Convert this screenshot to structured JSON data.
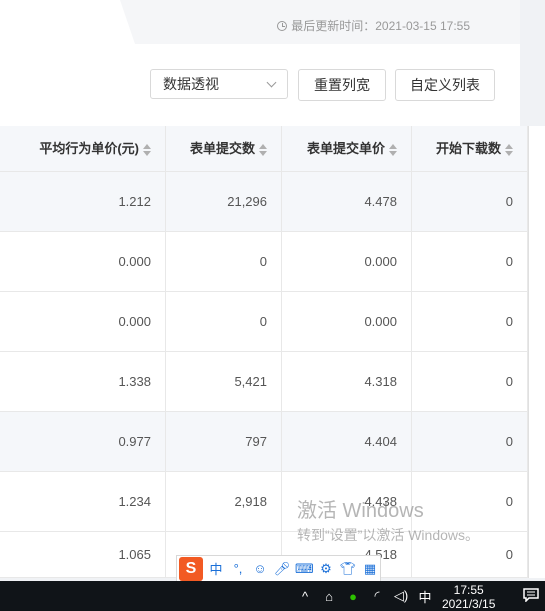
{
  "header": {
    "last_update": "最后更新时间：2021-03-15 17:55"
  },
  "toolbar": {
    "select_value": "数据透视",
    "reset_label": "重置列宽",
    "custom_label": "自定义列表"
  },
  "table": {
    "columns": [
      "平均行为单价(元)",
      "表单提交数",
      "表单提交单价",
      "开始下载数"
    ],
    "rows": [
      [
        "1.212",
        "21,296",
        "4.478",
        "0"
      ],
      [
        "0.000",
        "0",
        "0.000",
        "0"
      ],
      [
        "0.000",
        "0",
        "0.000",
        "0"
      ],
      [
        "1.338",
        "5,421",
        "4.318",
        "0"
      ],
      [
        "0.977",
        "797",
        "4.404",
        "0"
      ],
      [
        "1.234",
        "2,918",
        "4.438",
        "0"
      ],
      [
        "1.065",
        "",
        "4.518",
        "0"
      ]
    ]
  },
  "watermark": {
    "line1": "激活 Windows",
    "line2": "转到“设置”以激活 Windows。"
  },
  "ime": {
    "logo": "S",
    "lang": "中",
    "punct": "°,"
  },
  "taskbar": {
    "lang": "中",
    "time": "17:55",
    "date": "2021/3/15"
  }
}
